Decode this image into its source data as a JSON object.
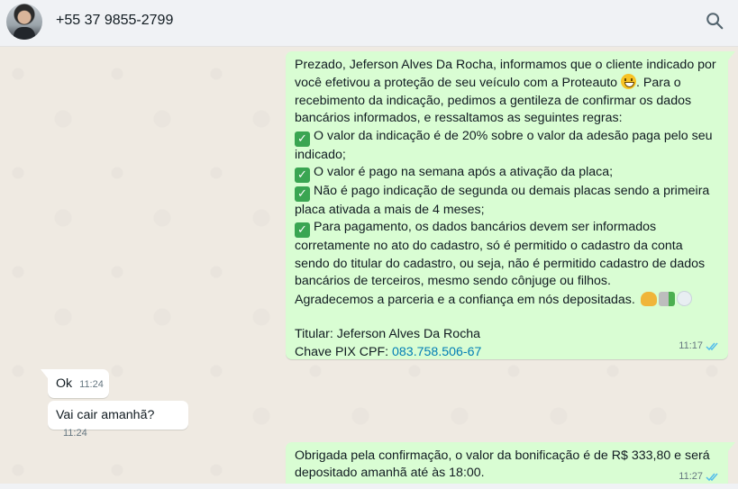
{
  "header": {
    "contact_name": "+55 37 9855-2799"
  },
  "messages": {
    "m1": {
      "lines": [
        "Prezado, Jeferson Alves Da Rocha, informamos que o cliente indicado por",
        "você efetivou a proteção de seu veículo com a Proteauto",
        ". Para o",
        "recebimento da indicação, pedimos a gentileza de confirmar os dados",
        "bancários informados, e  ressaltamos as seguintes regras:",
        "O valor da indicação é de 20% sobre o valor da adesão paga pelo seu",
        "indicado;",
        "O valor é pago na semana após a ativação da placa;",
        "Não é pago indicação de segunda ou demais placas sendo a primeira",
        "placa ativada a mais de 4 meses;",
        "Para pagamento, os dados bancários devem ser informados",
        "corretamente no ato do cadastro, só é permitido o cadastro da conta",
        "sendo do titular do cadastro, ou seja, não é permitido cadastro de dados",
        "bancários de terceiros, mesmo sendo cônjuge ou filhos.",
        "Agradecemos a parceria e a confiança em nós depositadas.",
        "Titular: Jeferson Alves Da Rocha",
        "Chave PIX CPF: ",
        "083.758.506-67"
      ],
      "time": "11:17",
      "check_glyph": "✓"
    },
    "m2": {
      "text": "Ok",
      "time": "11:24"
    },
    "m3": {
      "text": "Vai cair amanhã?",
      "time": "11:24"
    },
    "m4": {
      "lines": [
        "Obrigada pela confirmação, o valor da bonificação é de R$ 333,80 e será",
        "depositado amanhã até às 18:00."
      ],
      "time": "11:27"
    }
  },
  "colors": {
    "outgoing_bubble": "#d9fdd3",
    "incoming_bubble": "#ffffff",
    "read_ticks": "#53bdeb",
    "link": "#027eb5"
  },
  "icons": {
    "search": "search-icon",
    "check": "check-mark-button-icon",
    "read_receipt": "double-check-icon"
  }
}
